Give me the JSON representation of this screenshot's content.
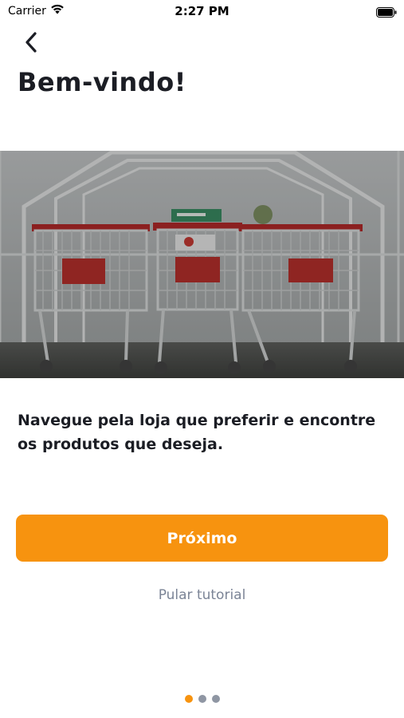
{
  "status_bar": {
    "carrier": "Carrier",
    "time": "2:27 PM"
  },
  "header": {
    "back_icon": "chevron-left-icon",
    "title": "Bem-vindo!"
  },
  "hero_image": {
    "subject": "shopping-carts-photo"
  },
  "content": {
    "description": "Navegue pela loja que preferir e encontre os produtos que deseja."
  },
  "actions": {
    "next_label": "Próximo",
    "skip_label": "Pular tutorial"
  },
  "pagination": {
    "current": 1,
    "total": 3
  },
  "colors": {
    "accent": "#f7930f",
    "text": "#1b1d24",
    "muted": "#7b8496",
    "dot_inactive": "#8f96a3"
  }
}
